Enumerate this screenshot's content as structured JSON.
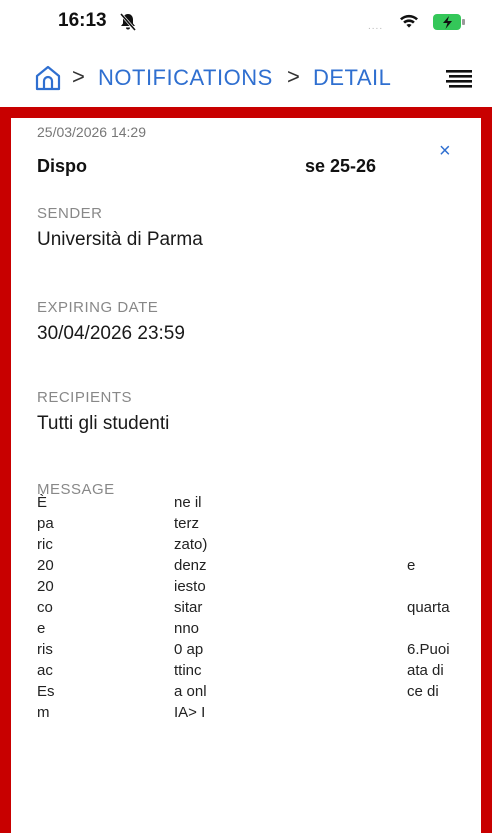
{
  "status_bar": {
    "time": "16:13",
    "signal_dots": "....",
    "bell_icon": "bell-slash-icon",
    "wifi_icon": "wifi-icon",
    "battery_icon": "battery-charging-icon",
    "battery_color": "#34c759"
  },
  "breadcrumb": {
    "home_icon": "home-icon",
    "separator": ">",
    "items": [
      "NOTIFICATIONS",
      "DETAIL"
    ],
    "link_color": "#2f6fd0",
    "menu_icon": "menu-icon"
  },
  "detail": {
    "border_color": "#c80000",
    "date": "25/03/2026 14:29",
    "title_start": "Dispo",
    "title_end": "se 25-26",
    "close_label": "×",
    "sender_label": "SENDER",
    "sender_value": "Università di Parma",
    "expiring_label": "EXPIRING DATE",
    "expiring_value": "30/04/2026 23:59",
    "recipients_label": "RECIPIENTS",
    "recipients_value": "Tutti gli studenti",
    "message_label": "MESSAGE",
    "message_fragments": [
      [
        "È",
        "ne il",
        ""
      ],
      [
        "pa",
        "terz",
        ""
      ],
      [
        "ric",
        "zato)",
        ""
      ],
      [
        "20",
        "denz",
        "e"
      ],
      [
        "20",
        "iesto",
        ""
      ],
      [
        "co",
        "sitar",
        "quarta"
      ],
      [
        "e",
        "nno",
        ""
      ],
      [
        "ris",
        "0 ap",
        "6.Puoi"
      ],
      [
        "ac",
        "ttinc",
        "ata di"
      ],
      [
        "Es",
        "a onl",
        "ce di"
      ],
      [
        "m",
        "IA> I",
        ""
      ]
    ]
  }
}
